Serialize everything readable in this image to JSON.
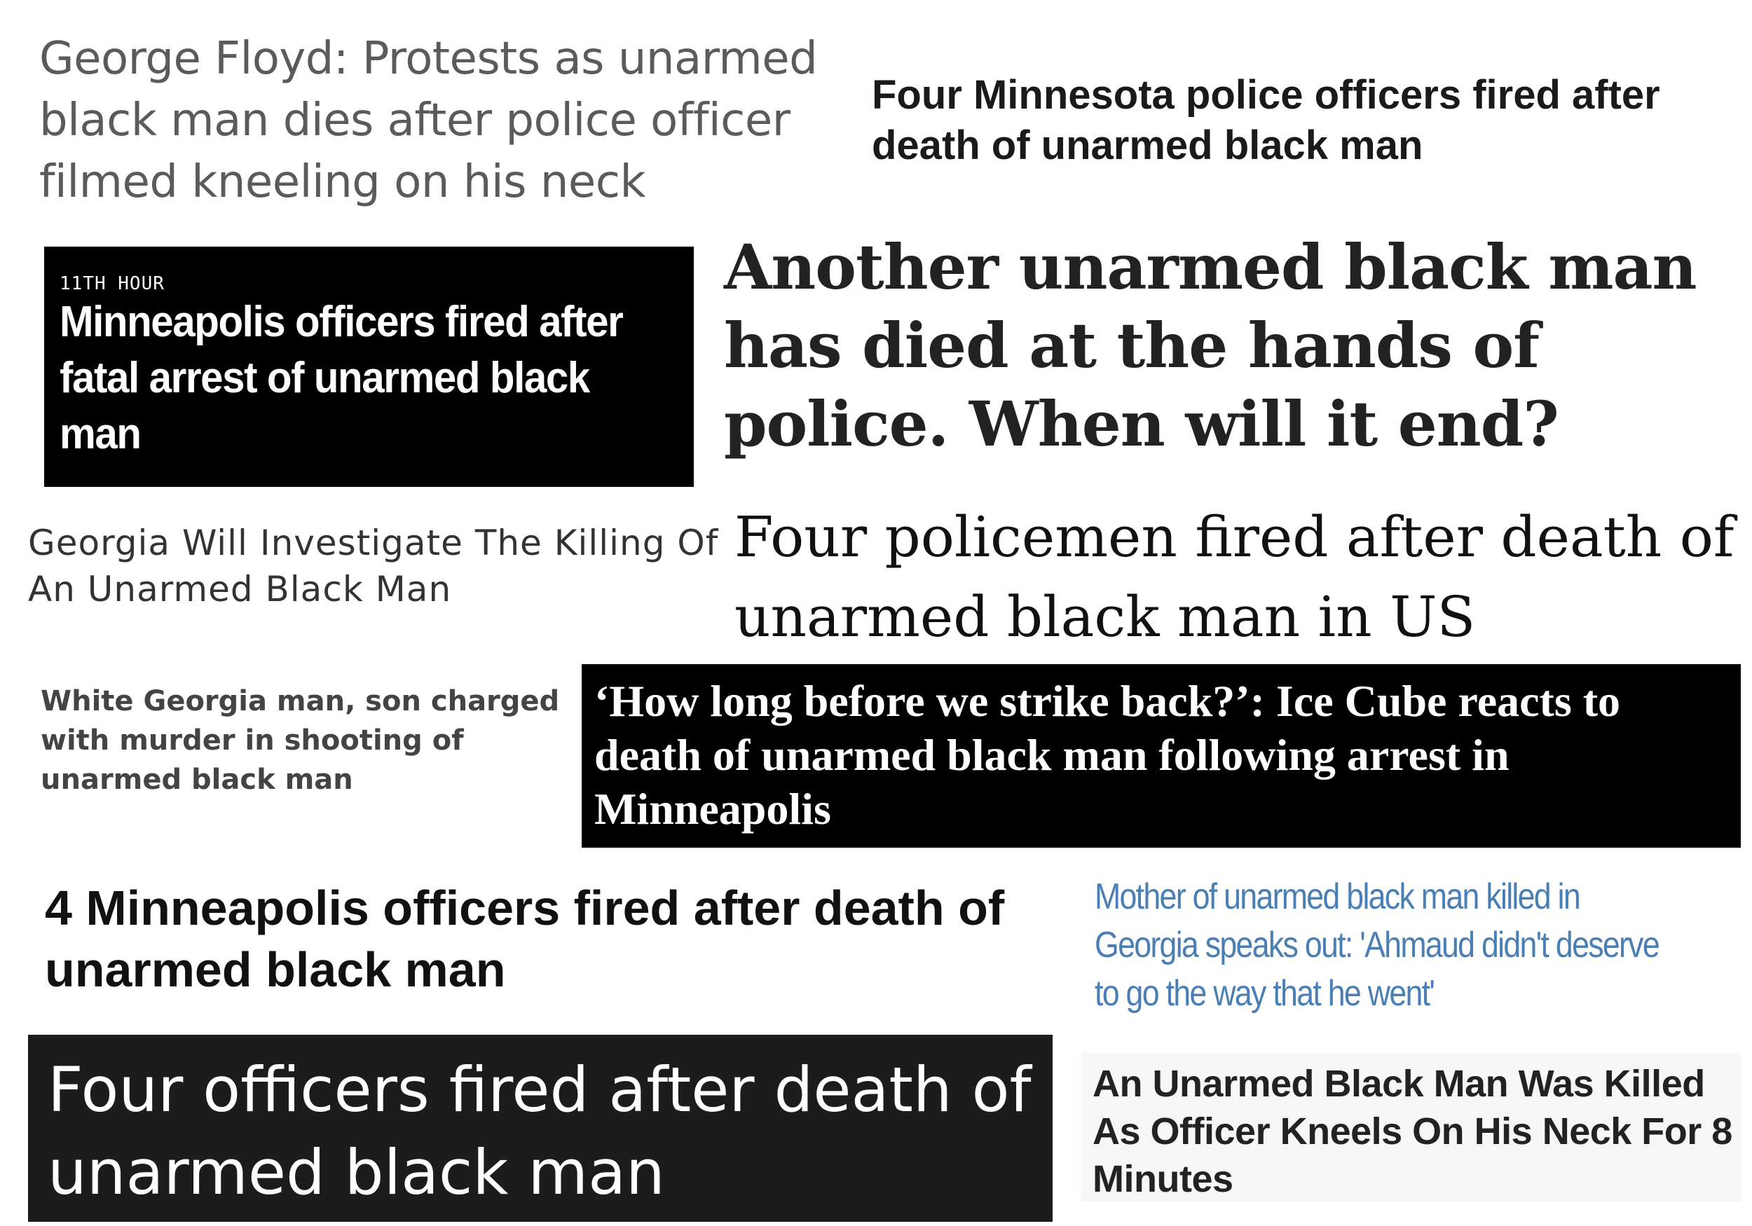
{
  "headlines": [
    {
      "text": "George Floyd: Protests as unarmed black man dies after police officer filmed kneeling on his neck",
      "color": "#5b5b5b"
    },
    {
      "text": "Four Minnesota police officers fired after death of unarmed black man",
      "color": "#1a1a1a"
    },
    {
      "kicker": "11TH HOUR",
      "text": "Minneapolis officers fired after fatal arrest of unarmed black man",
      "background": "#000000",
      "color": "#ffffff"
    },
    {
      "text": "Another unarmed black man has died at the hands of police. When will it end?",
      "color": "#222222"
    },
    {
      "text": "Georgia Will Investigate The Killing Of An Unarmed Black Man",
      "color": "#333333"
    },
    {
      "text": "Four policemen fired after death of unarmed black man in US",
      "color": "#111111"
    },
    {
      "text": "White Georgia man, son charged with murder in shooting of unarmed black man",
      "color": "#444444"
    },
    {
      "text": "‘How long before we strike back?’: Ice Cube reacts to death of unarmed black man following arrest in Minneapolis",
      "background": "#000000",
      "color": "#ffffff"
    },
    {
      "text": "4 Minneapolis officers fired after death of unarmed black man",
      "color": "#111111"
    },
    {
      "text": "Mother of unarmed black man killed in Georgia speaks out: 'Ahmaud didn't deserve to go the way that he went'",
      "color": "#4a7fb5"
    },
    {
      "text": "Four officers fired after death of unarmed black man",
      "background": "#1c1c1c",
      "color": "#ffffff"
    },
    {
      "text": "An Unarmed Black Man Was Killed As Officer Kneels On His Neck For 8 Minutes",
      "background": "#f6f6f6",
      "color": "#222222"
    }
  ]
}
